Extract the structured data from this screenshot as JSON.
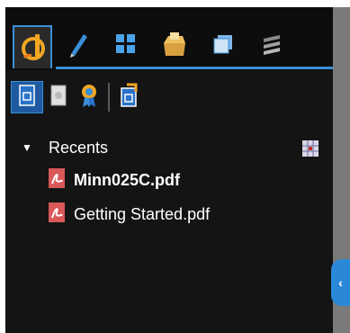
{
  "tabs": [
    {
      "name": "signatures-tab",
      "icon": "signature-icon",
      "active": true
    },
    {
      "name": "pen-tab",
      "icon": "pen-icon"
    },
    {
      "name": "thumbnails-tab",
      "icon": "thumbnails-grid-icon"
    },
    {
      "name": "attachments-tab",
      "icon": "attachments-box-icon"
    },
    {
      "name": "layers-tab",
      "icon": "layers-icon"
    },
    {
      "name": "stack-tab",
      "icon": "stack-icon"
    }
  ],
  "subtoolbar": {
    "buttons": [
      {
        "icon": "document-icon",
        "active": true
      },
      {
        "icon": "page-icon"
      },
      {
        "icon": "certificate-icon"
      },
      {
        "icon": "document-arrow-icon"
      }
    ]
  },
  "tree": {
    "group_label": "Recents",
    "files": [
      {
        "name": "Minn025C.pdf",
        "icon": "pdf-file-icon"
      },
      {
        "name": "Getting Started.pdf",
        "icon": "pdf-file-icon"
      }
    ]
  },
  "colors": {
    "panel_bg": "#141414",
    "accent": "#3a8fd8",
    "scrollbar": "#7a7a7a"
  }
}
